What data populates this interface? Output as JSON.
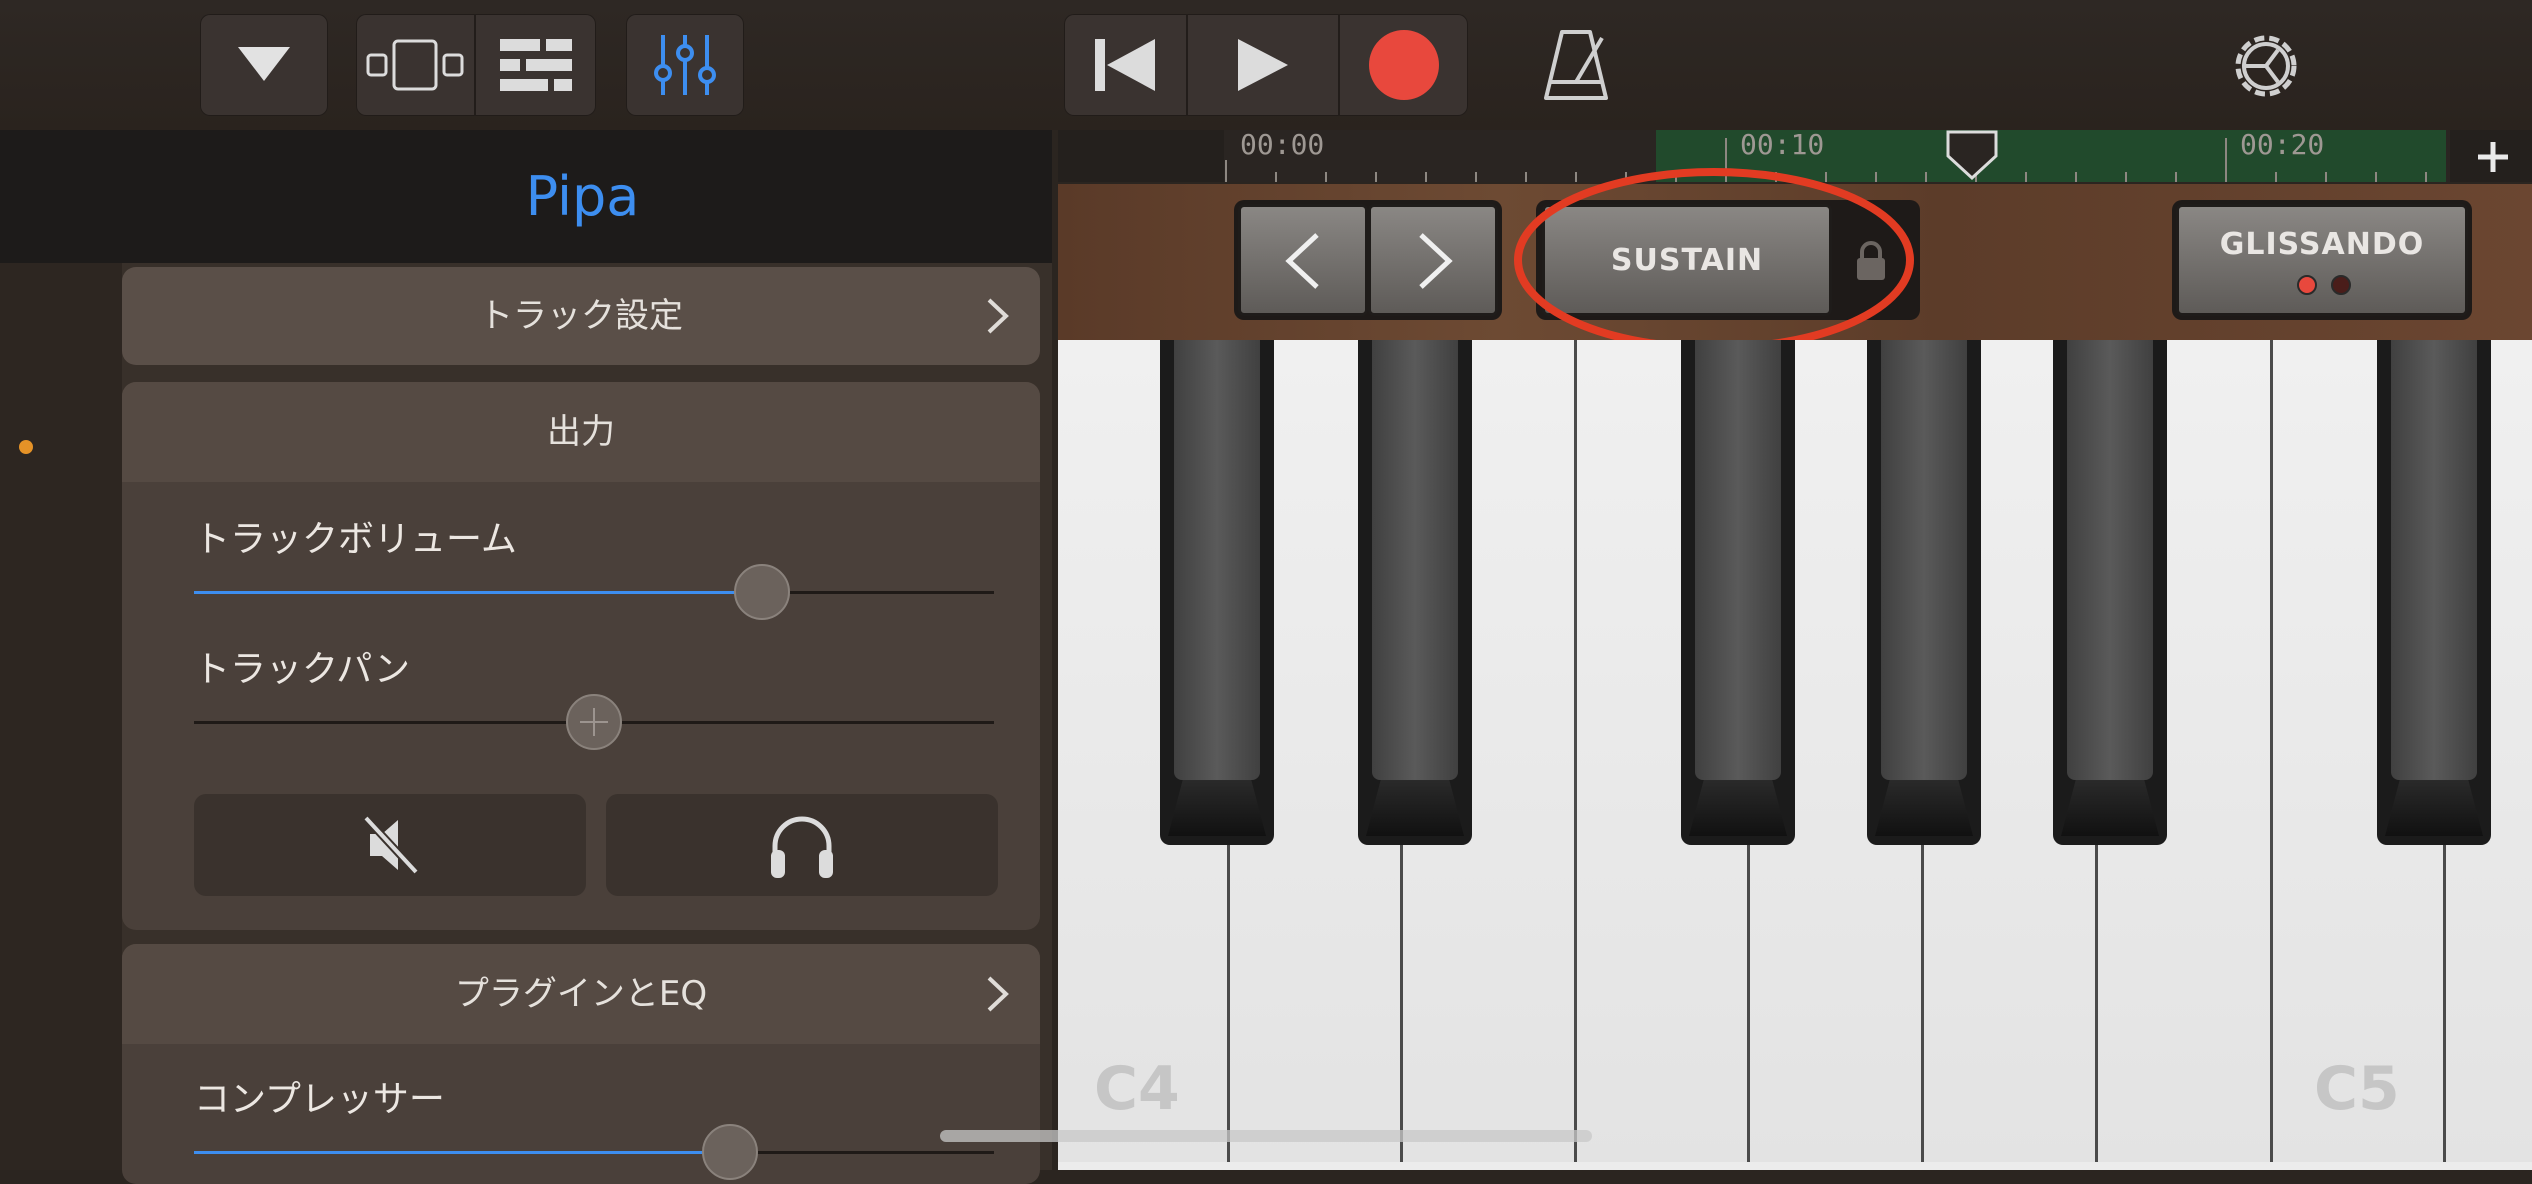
{
  "track_panel": {
    "title": "Pipa",
    "track_settings": "トラック設定",
    "output": {
      "heading": "出力",
      "track_volume_label": "トラックボリューム",
      "track_volume_value": 0.71,
      "track_pan_label": "トラックパン",
      "track_pan_value": 0.5
    },
    "plugins_eq": "プラグインとEQ",
    "compressor": {
      "label": "コンプレッサー",
      "value": 0.67
    }
  },
  "timeline": {
    "markers": [
      "00:00",
      "00:10",
      "00:20"
    ]
  },
  "instrument": {
    "sustain_label": "SUSTAIN",
    "glissando_label": "GLISSANDO",
    "keys": [
      "C4",
      "C5"
    ]
  },
  "colors": {
    "accent": "#3d8ef0",
    "record": "#e8483d",
    "highlight_circle": "#e23b22",
    "track_dot": "#e59227"
  }
}
